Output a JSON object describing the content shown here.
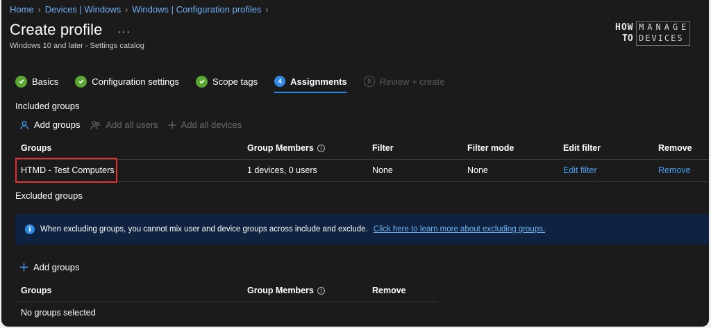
{
  "breadcrumb": [
    "Home",
    "Devices | Windows",
    "Windows | Configuration profiles"
  ],
  "header": {
    "title": "Create profile",
    "more": "...",
    "subtitle": "Windows 10 and later - Settings catalog"
  },
  "logo": {
    "how": "HOW",
    "to": "TO",
    "manage": "MANAGE",
    "devices": "DEVICES"
  },
  "steps": [
    {
      "label": "Basics",
      "state": "done"
    },
    {
      "label": "Configuration settings",
      "state": "done"
    },
    {
      "label": "Scope tags",
      "state": "done"
    },
    {
      "label": "Assignments",
      "state": "active",
      "number": "4"
    },
    {
      "label": "Review + create",
      "state": "disabled",
      "number": "5"
    }
  ],
  "included": {
    "label": "Included groups",
    "commands": {
      "add_groups": "Add groups",
      "add_all_users": "Add all users",
      "add_all_devices": "Add all devices"
    },
    "columns": [
      "Groups",
      "Group Members",
      "Filter",
      "Filter mode",
      "Edit filter",
      "Remove"
    ],
    "rows": [
      {
        "group": "HTMD - Test Computers",
        "members": "1 devices, 0 users",
        "filter": "None",
        "filter_mode": "None",
        "edit_filter": "Edit filter",
        "remove": "Remove"
      }
    ]
  },
  "excluded": {
    "label": "Excluded groups",
    "info_text": "When excluding groups, you cannot mix user and device groups across include and exclude.",
    "info_link": "Click here to learn more about excluding groups.",
    "add_groups": "Add groups",
    "columns": [
      "Groups",
      "Group Members",
      "Remove"
    ],
    "empty": "No groups selected"
  },
  "colors": {
    "accent": "#2f8be6",
    "success": "#5aa832",
    "highlight": "#e5322d",
    "background": "#1b1b1b"
  }
}
